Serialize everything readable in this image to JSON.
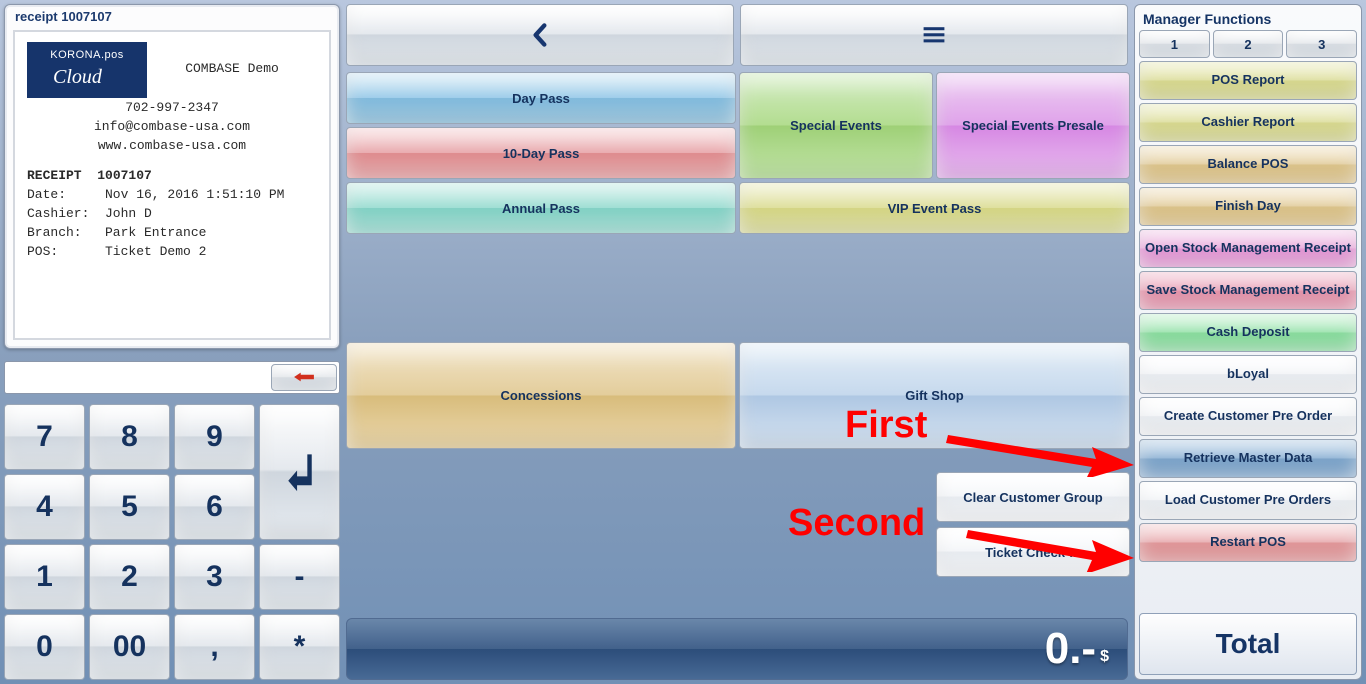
{
  "receipt": {
    "header": "receipt 1007107",
    "logo_line1": "KORONA.pos",
    "logo_line2": "Cloud",
    "company": "COMBASE Demo",
    "phone": "702-997-2347",
    "email": "info@combase-usa.com",
    "web": "www.combase-usa.com",
    "number_label": "RECEIPT",
    "number": "1007107",
    "rows": [
      {
        "k": "Date:",
        "v": "Nov 16, 2016 1:51:10 PM"
      },
      {
        "k": "Cashier:",
        "v": "John D"
      },
      {
        "k": "Branch:",
        "v": "Park Entrance"
      },
      {
        "k": "POS:",
        "v": "Ticket Demo 2"
      }
    ]
  },
  "keypad": {
    "k7": "7",
    "k8": "8",
    "k9": "9",
    "enter": "↲",
    "k4": "4",
    "k5": "5",
    "k6": "6",
    "k1": "1",
    "k2": "2",
    "k3": "3",
    "dash": "-",
    "k0": "0",
    "k00": "00",
    "dot": ",",
    "star": "*"
  },
  "tiles": {
    "day_pass": "Day Pass",
    "ten_day": "10-Day Pass",
    "annual": "Annual Pass",
    "special": "Special Events",
    "special_pre": "Special Events Presale",
    "vip": "VIP Event Pass",
    "concessions": "Concessions",
    "gift": "Gift Shop",
    "clear_group": "Clear Customer Group",
    "ticket_check": "Ticket Check-In"
  },
  "total_display": "0.-",
  "total_currency": "$",
  "manager": {
    "title": "Manager Functions",
    "tabs": [
      "1",
      "2",
      "3"
    ],
    "buttons": [
      {
        "label": "POS Report",
        "cls": "olive"
      },
      {
        "label": "Cashier Report",
        "cls": "olive"
      },
      {
        "label": "Balance POS",
        "cls": "sand"
      },
      {
        "label": "Finish Day",
        "cls": "sand"
      },
      {
        "label": "Open Stock Management Receipt",
        "cls": "pink"
      },
      {
        "label": "Save Stock Management Receipt",
        "cls": "magenta"
      },
      {
        "label": "Cash Deposit",
        "cls": "mint"
      },
      {
        "label": "bLoyal",
        "cls": "white"
      },
      {
        "label": "Create Customer Pre Order",
        "cls": "white"
      },
      {
        "label": "Retrieve Master Data",
        "cls": "steel"
      },
      {
        "label": "Load Customer Pre Orders",
        "cls": "white"
      },
      {
        "label": "Restart POS",
        "cls": "red"
      }
    ],
    "total": "Total"
  },
  "annotations": {
    "first": "First",
    "second": "Second"
  }
}
